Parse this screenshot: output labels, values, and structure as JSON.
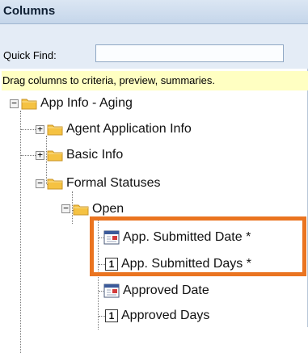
{
  "panel": {
    "title": "Columns",
    "quick_find_label": "Quick Find:",
    "quick_find_value": "",
    "hint": "Drag columns to criteria, preview, summaries."
  },
  "tree": {
    "root": {
      "label": "App Info - Aging",
      "toggle": "−"
    },
    "agent_application_info": {
      "label": "Agent Application Info",
      "toggle": "+"
    },
    "basic_info": {
      "label": "Basic Info",
      "toggle": "+"
    },
    "formal_statuses": {
      "label": "Formal Statuses",
      "toggle": "−"
    },
    "open": {
      "label": "Open",
      "toggle": "−"
    },
    "app_submitted_date": {
      "label": "App. Submitted Date *"
    },
    "app_submitted_days": {
      "label": "App. Submitted Days *",
      "badge": "1"
    },
    "approved_date": {
      "label": "Approved Date"
    },
    "approved_days": {
      "label": "Approved Days",
      "badge": "1"
    }
  },
  "colors": {
    "highlight": "#ea7420",
    "header_bg": "#c5d6ea",
    "hint_bg": "#ffffc2",
    "folder": "#f5c242"
  }
}
